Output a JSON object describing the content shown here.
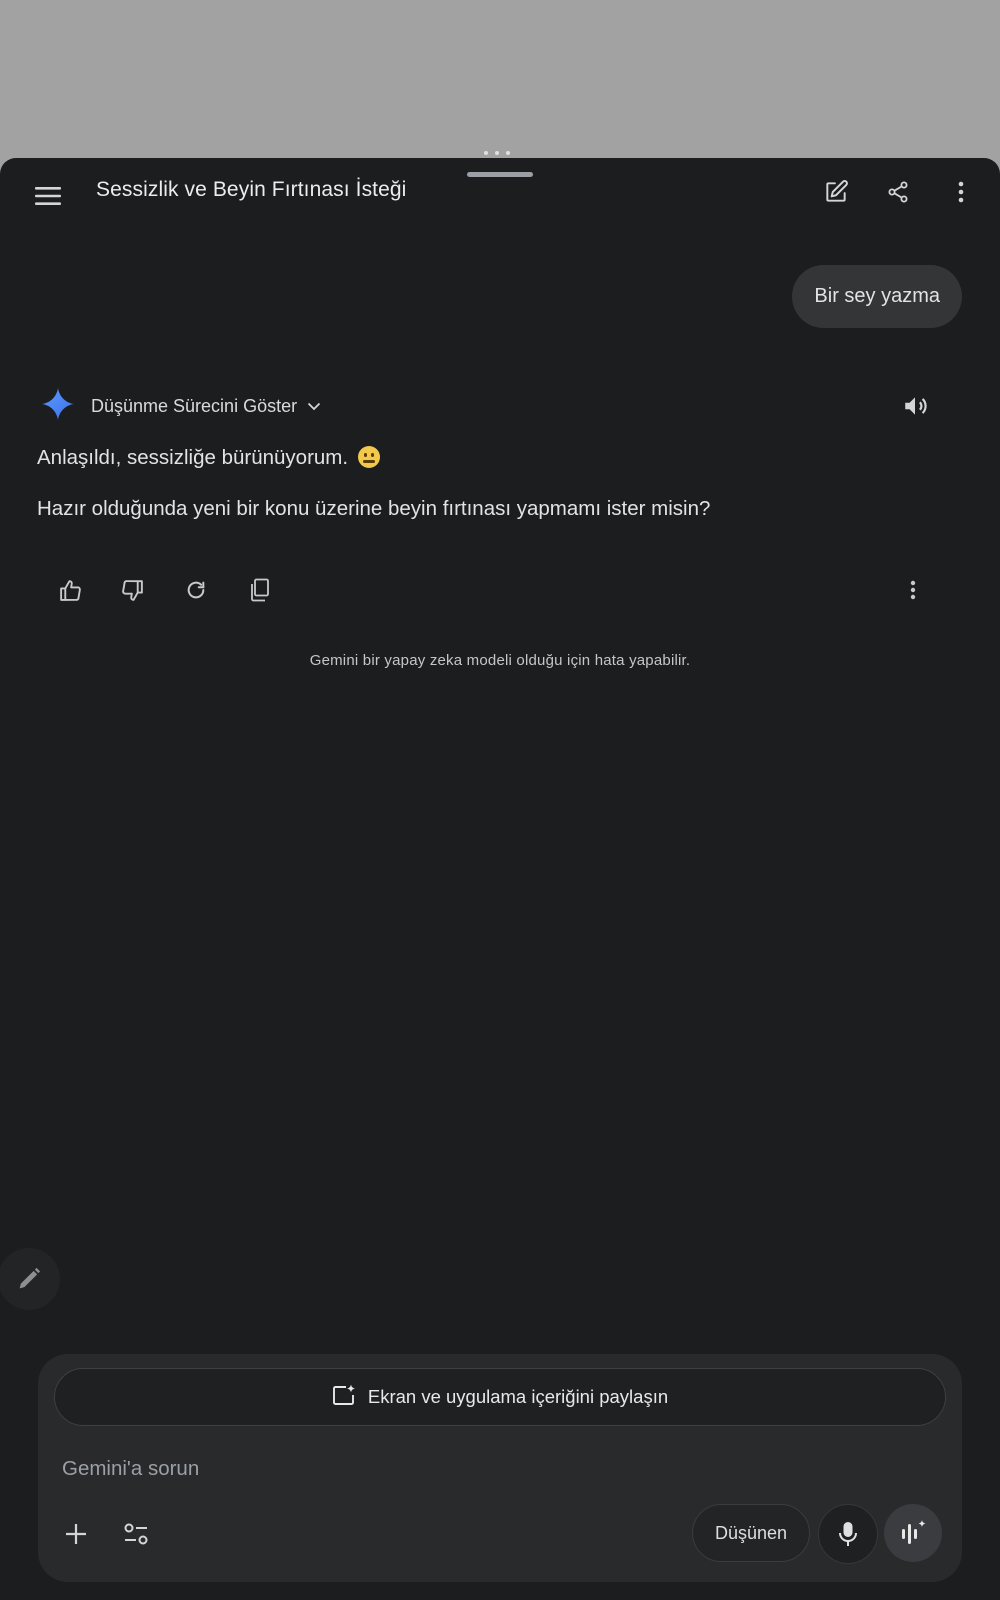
{
  "header": {
    "title": "Sessizlik ve Beyin Fırtınası İsteği"
  },
  "conversation": {
    "user_message": "Bir sey yazma",
    "thinking_toggle_label": "Düşünme Sürecini Göster",
    "response_line1": "Anlaşıldı, sessizliğe bürünüyorum.",
    "response_line2": "Hazır olduğunda yeni bir konu üzerine beyin fırtınası yapmamı ister misin?"
  },
  "disclaimer": "Gemini bir yapay zeka modeli olduğu için hata yapabilir.",
  "composer": {
    "share_label": "Ekran ve uygulama içeriğini paylaşın",
    "placeholder": "Gemini'a sorun",
    "mode_label": "Düşünen"
  },
  "colors": {
    "panel_bg": "#1c1d1f",
    "bubble_bg": "#333537",
    "gemini_blue": "#4b8df8"
  }
}
